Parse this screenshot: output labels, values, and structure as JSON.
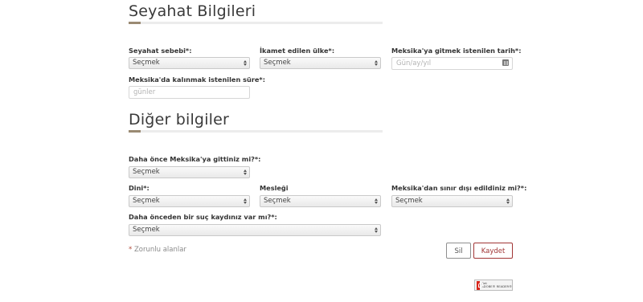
{
  "sections": {
    "travel": {
      "title": "Seyahat Bilgileri"
    },
    "other": {
      "title": "Diğer bilgiler"
    }
  },
  "fields": {
    "reason": {
      "label": "Seyahat sebebi*:",
      "value": "Seçmek"
    },
    "country": {
      "label": "İkamet edilen ülke*:",
      "value": "Seçmek"
    },
    "date": {
      "label": "Meksika'ya gitmek istenilen tarih*:",
      "placeholder": "Gün/ay/yıl",
      "icon": "calendar-icon"
    },
    "duration": {
      "label": "Meksika'da kalınmak istenilen süre*:",
      "placeholder": "günler"
    },
    "visited": {
      "label": "Daha önce Meksika'ya gittiniz mi?*:",
      "value": "Seçmek"
    },
    "religion": {
      "label": "Dini*:",
      "value": "Seçmek"
    },
    "profession": {
      "label": "Mesleği",
      "value": "Seçmek"
    },
    "deported": {
      "label": "Meksika'dan sınır dışı edildiniz mi?*:",
      "value": "Seçmek"
    },
    "criminal": {
      "label": "Daha önceden bir suç kaydınız var mı?*:",
      "value": "Seçmek"
    }
  },
  "footer": {
    "required_star": "*",
    "required_text": " Zorunlu alanlar",
    "delete_label": "Sil",
    "save_label": "Kaydet"
  },
  "badge": {
    "icon": "adobe-pdf-icon",
    "line1": "Get",
    "line2": "ADOBE® READER®"
  },
  "colors": {
    "accent": "#a13535",
    "rule": "#9a8a73"
  }
}
